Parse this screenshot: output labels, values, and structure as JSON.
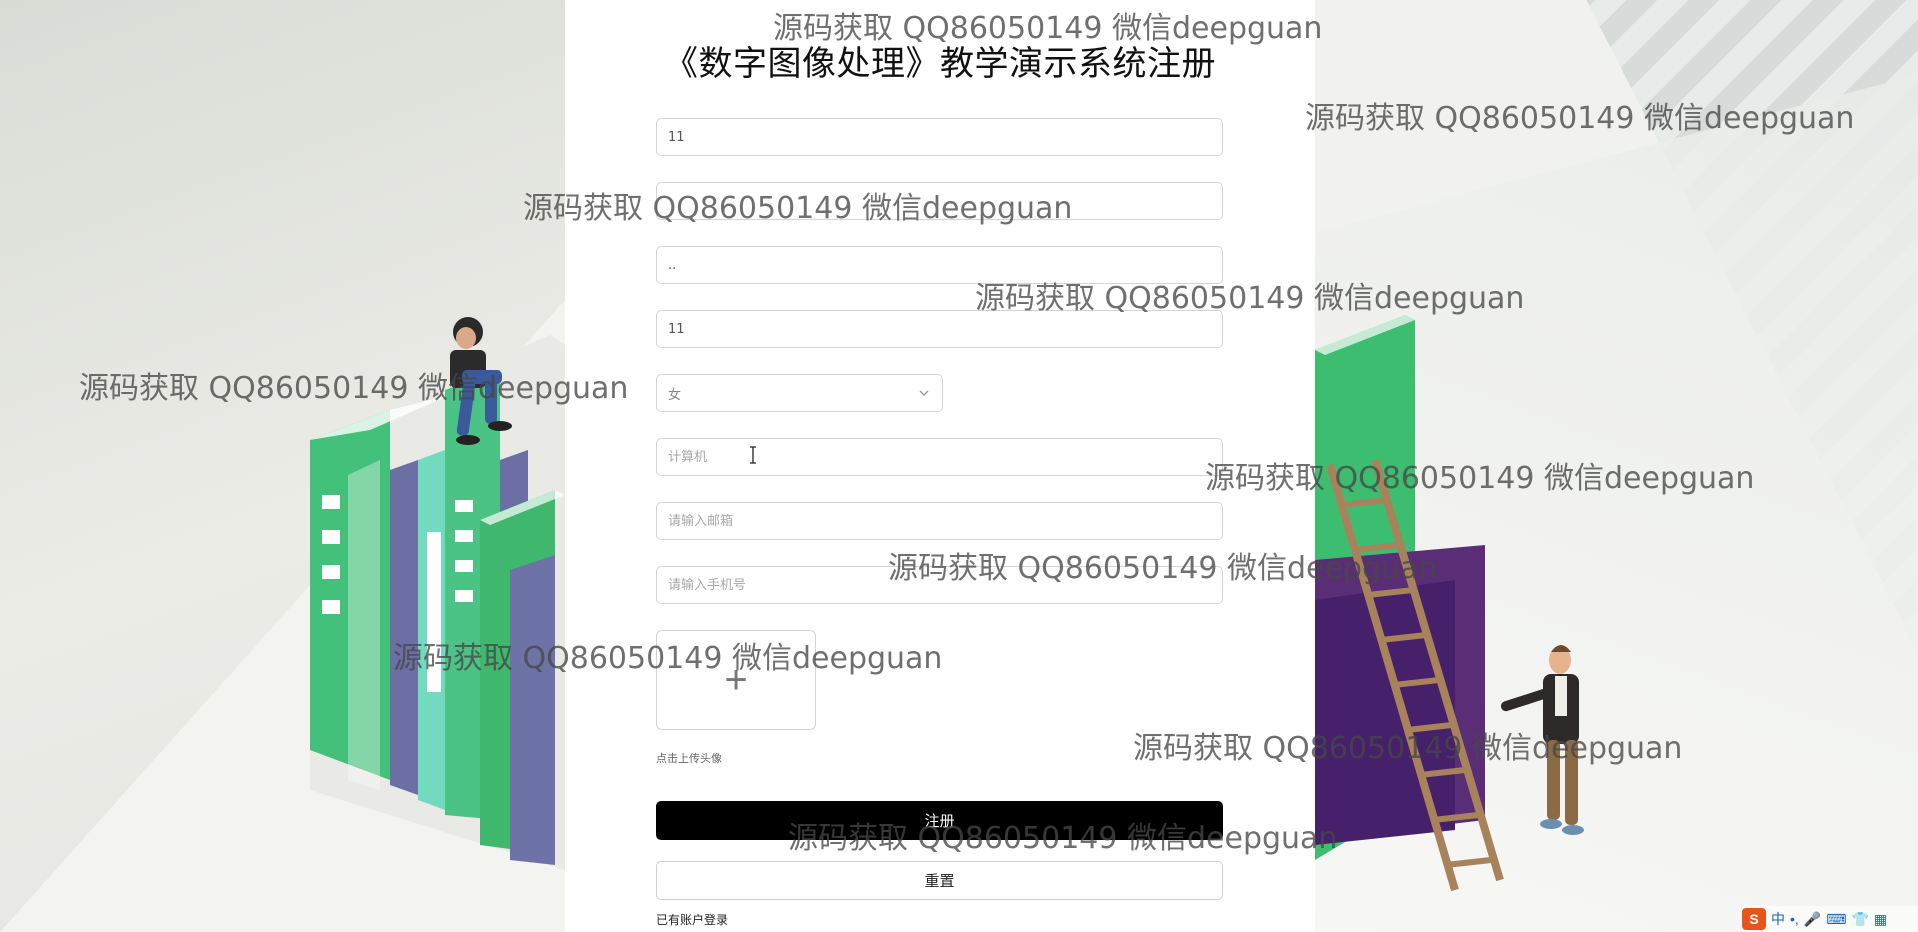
{
  "page": {
    "title": "《数字图像处理》教学演示系统注册"
  },
  "form": {
    "account": {
      "value": "11",
      "placeholder": ""
    },
    "password": {
      "value": "",
      "placeholder": ""
    },
    "confirm_password": {
      "value": "..",
      "placeholder": ""
    },
    "name": {
      "value": "11",
      "placeholder": ""
    },
    "gender": {
      "selected": "女"
    },
    "major": {
      "value": "",
      "placeholder": "计算机"
    },
    "email": {
      "value": "",
      "placeholder": "请输入邮箱"
    },
    "phone": {
      "value": "",
      "placeholder": "请输入手机号"
    },
    "avatar_upload_symbol": "+",
    "avatar_hint": "点击上传头像",
    "register_label": "注册",
    "reset_label": "重置",
    "login_link": "已有账户登录"
  },
  "watermark_text": "源码获取 QQ86050149 微信deepguan",
  "ime": {
    "logo": "S",
    "mode": "中",
    "punct": "•,",
    "mic": "🎤",
    "keyboard": "⌨",
    "skin": "👕",
    "menu": "▦"
  },
  "colors": {
    "primary_button": "#000000",
    "panel_background": "#ffffff",
    "book_green": "#3fbf72",
    "book_purple": "#4a2f6e"
  }
}
